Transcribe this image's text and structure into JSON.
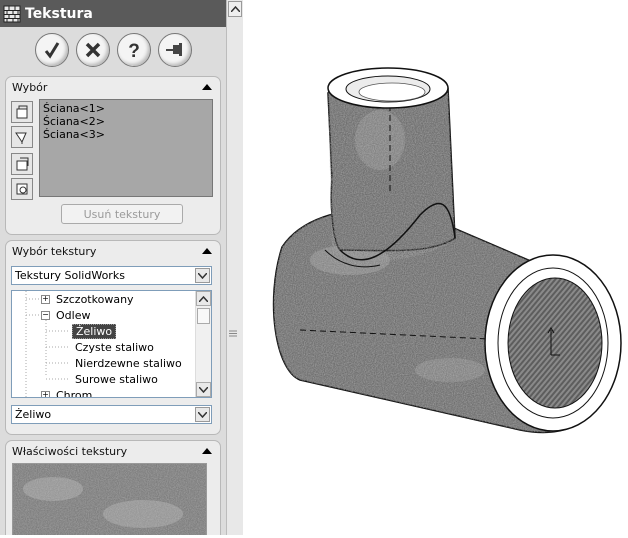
{
  "panel": {
    "title": "Tekstura",
    "actions": [
      {
        "name": "ok-button",
        "icon": "checkmark-icon"
      },
      {
        "name": "cancel-button",
        "icon": "close-x-icon"
      },
      {
        "name": "help-button",
        "icon": "question-icon"
      },
      {
        "name": "pin-button",
        "icon": "pushpin-icon"
      }
    ]
  },
  "selection": {
    "header": "Wybór",
    "items": [
      "Ściana<1>",
      "Ściana<2>",
      "Ściana<3>"
    ],
    "remove_button": "Usuń tekstury"
  },
  "texture_select": {
    "header": "Wybór tekstury",
    "library": "Tekstury SolidWorks",
    "tree": [
      {
        "label": "Szczotkowany",
        "level": 1,
        "expander": "+"
      },
      {
        "label": "Odlew",
        "level": 1,
        "expander": "−"
      },
      {
        "label": "Żeliwo",
        "level": 2,
        "selected": true
      },
      {
        "label": "Czyste staliwo",
        "level": 2
      },
      {
        "label": "Nierdzewne staliwo",
        "level": 2
      },
      {
        "label": "Surowe staliwo",
        "level": 2
      },
      {
        "label": "Chrom",
        "level": 1,
        "expander": "+"
      }
    ],
    "current": "Żeliwo"
  },
  "properties": {
    "header": "Właściwości tekstury"
  },
  "colors": {
    "titlebar": "#5a5a5a",
    "panel_bg": "#dcdcdc",
    "selection_box": "#a7a7a7",
    "model_cut_face": "#7a7a7a"
  }
}
